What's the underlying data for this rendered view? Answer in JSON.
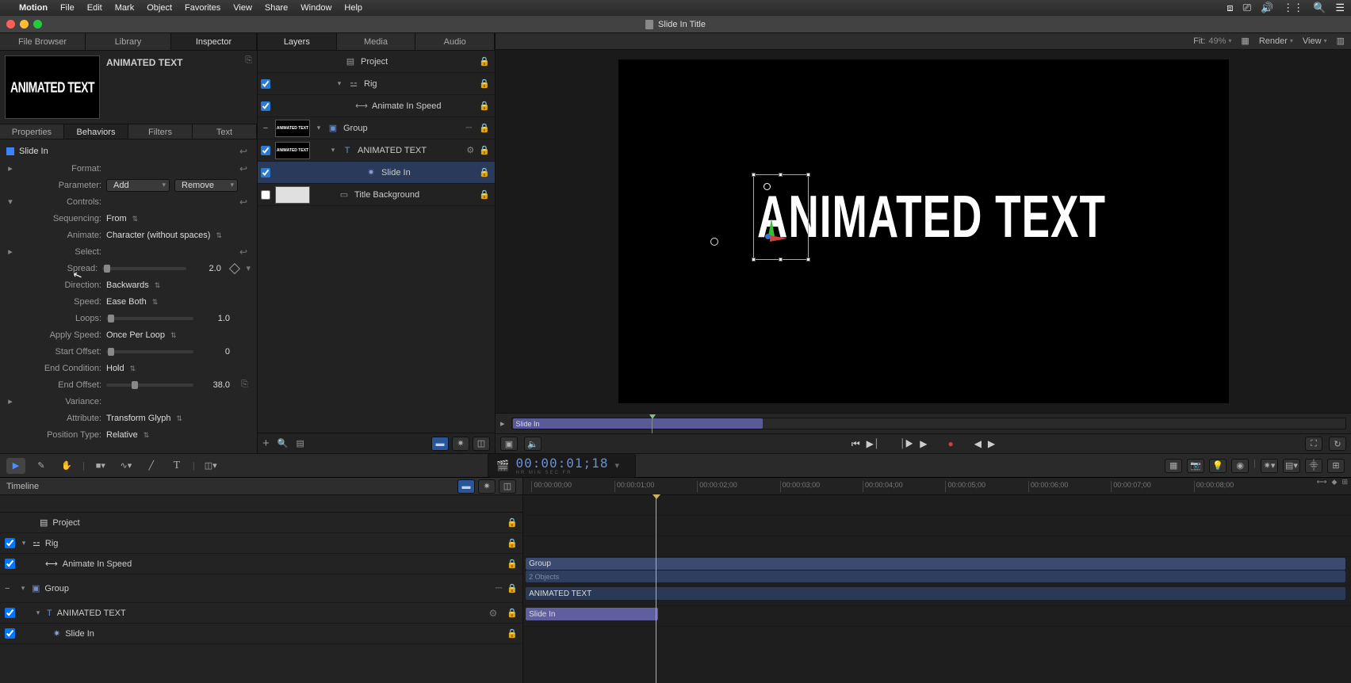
{
  "menubar": {
    "items": [
      "Motion",
      "File",
      "Edit",
      "Mark",
      "Object",
      "Favorites",
      "View",
      "Share",
      "Window",
      "Help"
    ]
  },
  "window": {
    "title": "Slide In Title"
  },
  "left": {
    "tabs": [
      "File Browser",
      "Library",
      "Inspector"
    ],
    "active_tab": 2,
    "preview_title": "ANIMATED TEXT",
    "subtabs": [
      "Properties",
      "Behaviors",
      "Filters",
      "Text"
    ],
    "subtab_active": 1,
    "behavior_name": "Slide In",
    "rows": {
      "format": "Format:",
      "parameter": "Parameter:",
      "add_btn": "Add",
      "remove_btn": "Remove",
      "controls": "Controls:",
      "sequencing_lbl": "Sequencing:",
      "sequencing_val": "From",
      "animate_lbl": "Animate:",
      "animate_val": "Character (without spaces)",
      "select_lbl": "Select:",
      "spread_lbl": "Spread:",
      "spread_val": "2.0",
      "direction_lbl": "Direction:",
      "direction_val": "Backwards",
      "speed_lbl": "Speed:",
      "speed_val": "Ease Both",
      "loops_lbl": "Loops:",
      "loops_val": "1.0",
      "applyspeed_lbl": "Apply Speed:",
      "applyspeed_val": "Once Per Loop",
      "startoffset_lbl": "Start Offset:",
      "startoffset_val": "0",
      "endcondition_lbl": "End Condition:",
      "endcondition_val": "Hold",
      "endoffset_lbl": "End Offset:",
      "endoffset_val": "38.0",
      "variance_lbl": "Variance:",
      "attribute_lbl": "Attribute:",
      "attribute_val": "Transform Glyph",
      "positiontype_lbl": "Position Type:",
      "positiontype_val": "Relative"
    }
  },
  "mid": {
    "tabs": [
      "Layers",
      "Media",
      "Audio"
    ],
    "active_tab": 0,
    "layers": [
      {
        "indent": 0,
        "check": null,
        "icon": "file",
        "name": "Project",
        "lock": true
      },
      {
        "indent": 1,
        "check": true,
        "disclosure": true,
        "icon": "rig",
        "name": "Rig",
        "lock": true
      },
      {
        "indent": 2,
        "check": true,
        "icon": "slider",
        "name": "Animate In Speed",
        "lock": true
      },
      {
        "indent": 1,
        "check": true,
        "thumb": "ANIMATED TEXT",
        "disclosure": true,
        "icon": "group",
        "name": "Group",
        "link": true,
        "lock": true,
        "minus": true
      },
      {
        "indent": 2,
        "check": true,
        "thumb": "ANIMATED TEXT",
        "disclosure": true,
        "icon": "text",
        "name": "ANIMATED TEXT",
        "gear": true,
        "lock": true
      },
      {
        "indent": 3,
        "check": true,
        "icon": "gear-star",
        "name": "Slide In",
        "lock": true,
        "selected": true
      },
      {
        "indent": 2,
        "check": false,
        "thumb_white": true,
        "icon": "rect",
        "name": "Title Background",
        "lock": true
      }
    ]
  },
  "viewer": {
    "fit_label": "Fit:",
    "fit_val": "49%",
    "render": "Render",
    "view": "View",
    "canvas_text": "ANIMATED TEXT",
    "mini_clip": "Slide In"
  },
  "toolbar2": {
    "timecode": "00:00:01;18",
    "sub": "HR   MIN   SEC   FR"
  },
  "timeline": {
    "title": "Timeline",
    "ticks": [
      "00:00:00;00",
      "00:00:01;00",
      "00:00:02;00",
      "00:00:03;00",
      "00:00:04;00",
      "00:00:05;00",
      "00:00:06;00",
      "00:00:07;00",
      "00:00:08;00"
    ],
    "layers": [
      {
        "indent": 0,
        "icon": "file",
        "name": "Project",
        "lock": true
      },
      {
        "indent": 1,
        "check": true,
        "disclosure": true,
        "icon": "rig",
        "name": "Rig",
        "lock": true
      },
      {
        "indent": 2,
        "check": true,
        "icon": "slider",
        "name": "Animate In Speed",
        "lock": true
      },
      {
        "indent": 1,
        "check": true,
        "disclosure": true,
        "icon": "group",
        "name": "Group",
        "link": true,
        "lock": true,
        "minus": true
      },
      {
        "indent": 2,
        "check": true,
        "disclosure": true,
        "icon": "text",
        "name": "ANIMATED TEXT",
        "gear": true,
        "lock": true
      },
      {
        "indent": 3,
        "check": true,
        "icon": "gear-star",
        "name": "Slide In",
        "lock": true
      }
    ],
    "clips": {
      "group": "Group",
      "group_sub": "2 Objects",
      "anim": "ANIMATED TEXT",
      "slide": "Slide In"
    }
  }
}
